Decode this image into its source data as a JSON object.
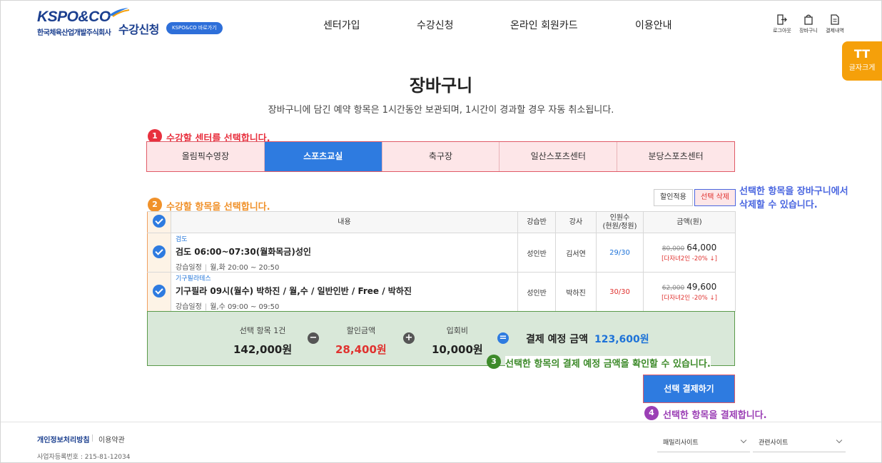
{
  "header": {
    "logo": "KSPO&CO",
    "logo_sub": "한국체육산업개발주식회사",
    "brand_title": "수강신청",
    "brand_button": "KSPO&CO 바로가기",
    "nav": [
      "센터가입",
      "수강신청",
      "온라인 회원카드",
      "이용안내"
    ],
    "utils": [
      {
        "label": "로그아웃",
        "icon": "logout-icon"
      },
      {
        "label": "장바구니",
        "icon": "shopping-bag-icon"
      },
      {
        "label": "결제내역",
        "icon": "document-icon"
      }
    ],
    "font_size_button": {
      "glyph": "TT",
      "label": "글자크게"
    }
  },
  "page": {
    "title": "장바구니",
    "description": "장바구니에 담긴 예약 항목은 1시간동안 보관되며, 1시간이 경과할 경우 자동 취소됩니다."
  },
  "annotations": [
    {
      "num": "1",
      "text": "수강할 센터를 선택합니다.",
      "color": "#e8303e"
    },
    {
      "num": "2",
      "text": "수강할 항목을 선택합니다.",
      "color": "#f0912a"
    },
    {
      "num": "3",
      "text": "선택한 항목의 결제 예정 금액을 확인할 수 있습니다.",
      "color": "#3d8a2a"
    },
    {
      "num": "4",
      "text": "선택한 항목을 결제합니다.",
      "color": "#9b3fb5"
    },
    {
      "text_line1": "선택한 항목을 장바구니에서",
      "text_line2": "삭제할 수 있습니다.",
      "color": "#4a66e0"
    }
  ],
  "centers": {
    "tabs": [
      "올림픽수영장",
      "스포츠교실",
      "축구장",
      "일산스포츠센터",
      "분당스포츠센터"
    ],
    "active_index": 1
  },
  "actions": {
    "apply_discount": "할인적용",
    "delete_selected": "선택 삭제"
  },
  "table": {
    "headers": [
      "내용",
      "강습반",
      "강사",
      "인원수\n(현원/정원)",
      "금액(원)"
    ],
    "rows": [
      {
        "category": "검도",
        "class_name": "검도 06:00~07:30(월화목금)성인",
        "schedule_label": "강습일정",
        "schedule": "월,화 20:00 ~ 20:50",
        "group": "성인반",
        "instructor": "김서연",
        "count": "29/30",
        "count_color": "#1d72d8",
        "original_price": "80,000",
        "price": "64,000",
        "discount": "[다자녀2인 -20% ↓]"
      },
      {
        "category": "기구필라테스",
        "class_name": "기구필라 09시(월수) 박하진 / 월,수 / 일반인반 / Free / 박하진",
        "schedule_label": "강습일정",
        "schedule": "월,수 09:00 ~ 09:50",
        "group": "성인반",
        "instructor": "박하진",
        "count": "30/30",
        "count_color": "#e0322f",
        "original_price": "62,000",
        "price": "49,600",
        "discount": "[다자녀2인 -20% ↓]"
      }
    ]
  },
  "summary": {
    "selected_label": "선택 항목 1건",
    "selected_value": "142,000원",
    "discount_label": "할인금액",
    "discount_value": "28,400원",
    "fee_label": "입회비",
    "fee_value": "10,000원",
    "total_label": "결제 예정 금액",
    "total_value": "123,600원",
    "op_minus": "−",
    "op_plus": "+",
    "op_equals": "="
  },
  "pay_button": "선택 결제하기",
  "footer": {
    "privacy": "개인정보처리방침",
    "terms": "이용약관",
    "registration": "사업자등록번호 : 215-81-12034",
    "family_site": "패밀리사이트",
    "related_site": "관련사이트"
  }
}
